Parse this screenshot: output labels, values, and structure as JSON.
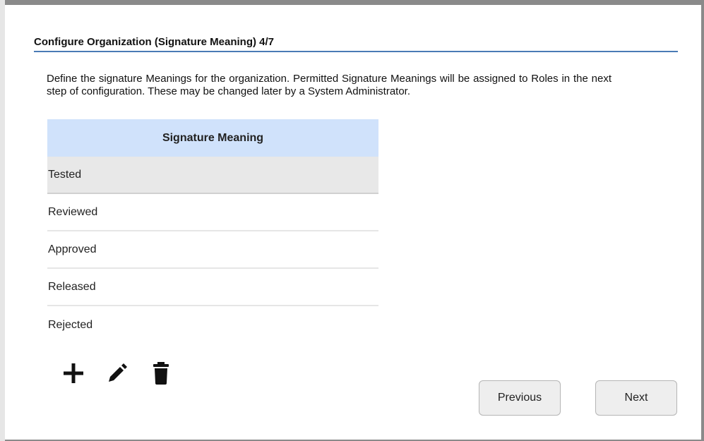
{
  "dialog": {
    "title": "Configure Organization (Signature Meaning) 4/7",
    "description": "Define the signature Meanings for the organization. Permitted Signature Meanings will be assigned to Roles in the next step of configuration. These may be changed later by a System Administrator."
  },
  "table": {
    "header": "Signature Meaning",
    "rows": [
      {
        "label": "Tested",
        "selected": true
      },
      {
        "label": "Reviewed",
        "selected": false
      },
      {
        "label": "Approved",
        "selected": false
      },
      {
        "label": "Released",
        "selected": false
      },
      {
        "label": "Rejected",
        "selected": false
      }
    ]
  },
  "toolbar": {
    "icons": [
      "plus-icon",
      "pencil-icon",
      "trash-icon"
    ]
  },
  "buttons": {
    "previous": "Previous",
    "next": "Next"
  },
  "colors": {
    "header_bg": "#d0e2fb",
    "selected_row_bg": "#e8e8e8",
    "title_underline": "#4a7bb5"
  }
}
